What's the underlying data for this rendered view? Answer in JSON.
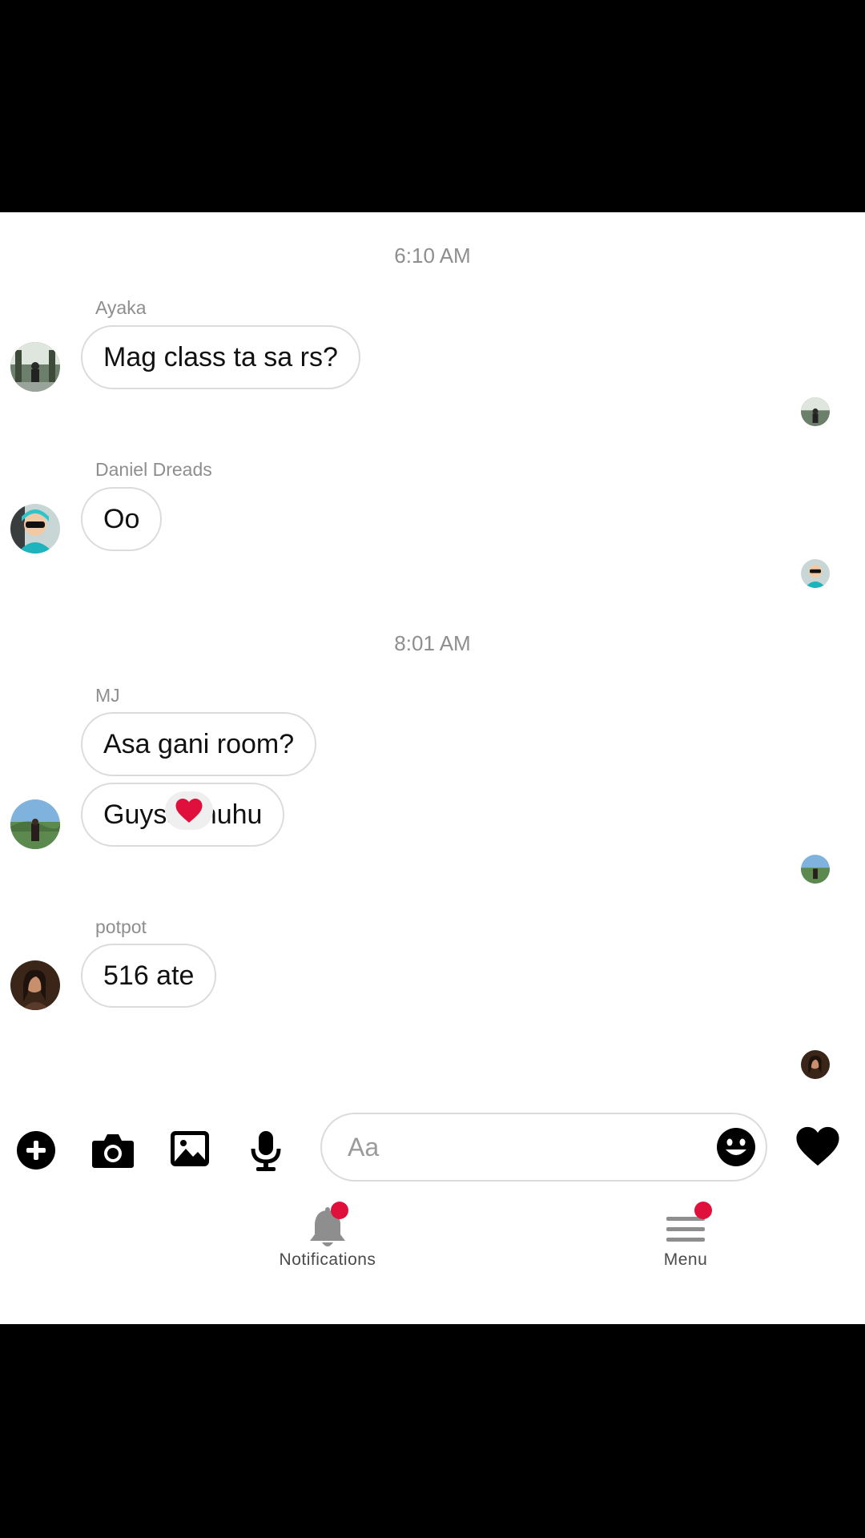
{
  "conversation": {
    "timestamps": [
      "6:10 AM",
      "8:01 AM"
    ],
    "groups": [
      {
        "sender": "Ayaka",
        "messages": [
          "Mag class ta sa rs?"
        ]
      },
      {
        "sender": "Daniel Dreads",
        "messages": [
          "Oo"
        ]
      },
      {
        "sender": "MJ",
        "messages": [
          "Asa gani room?",
          "Guysss huhu"
        ]
      },
      {
        "sender": "potpot",
        "messages": [
          "516 ate"
        ],
        "reaction": "heart"
      }
    ]
  },
  "composer": {
    "icons": [
      "plus-circle-icon",
      "camera-icon",
      "image-icon",
      "microphone-icon",
      "emoji-icon",
      "heart-icon"
    ],
    "placeholder": "Aa"
  },
  "tabbar": {
    "items": [
      {
        "label": "Notifications",
        "icon": "bell-icon",
        "badge": true
      },
      {
        "label": "Menu",
        "icon": "menu-icon",
        "badge": true
      }
    ]
  },
  "colors": {
    "badge": "#e0103d",
    "reaction": "#e0103d",
    "timestamp": "#8e8e8e"
  }
}
